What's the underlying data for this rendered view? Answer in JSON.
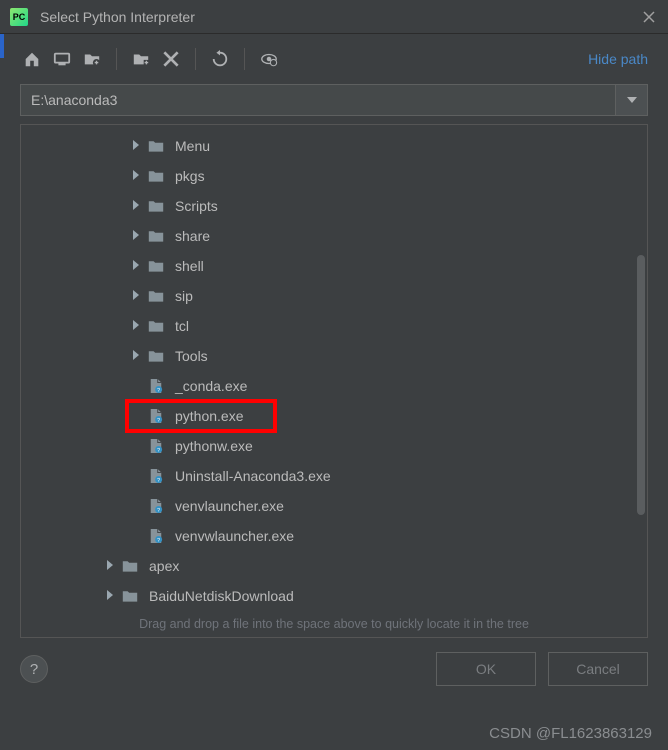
{
  "titlebar": {
    "app_icon_text": "PC",
    "title": "Select Python Interpreter"
  },
  "toolbar": {
    "hide_path_link": "Hide path"
  },
  "path_input": {
    "value": "E:\\anaconda3"
  },
  "tree": {
    "items": [
      {
        "indent": 3,
        "expandable": true,
        "type": "folder",
        "label": "Menu"
      },
      {
        "indent": 3,
        "expandable": true,
        "type": "folder",
        "label": "pkgs"
      },
      {
        "indent": 3,
        "expandable": true,
        "type": "folder",
        "label": "Scripts"
      },
      {
        "indent": 3,
        "expandable": true,
        "type": "folder",
        "label": "share"
      },
      {
        "indent": 3,
        "expandable": true,
        "type": "folder",
        "label": "shell"
      },
      {
        "indent": 3,
        "expandable": true,
        "type": "folder",
        "label": "sip"
      },
      {
        "indent": 3,
        "expandable": true,
        "type": "folder",
        "label": "tcl"
      },
      {
        "indent": 3,
        "expandable": true,
        "type": "folder",
        "label": "Tools"
      },
      {
        "indent": 3,
        "expandable": false,
        "type": "file",
        "label": "_conda.exe"
      },
      {
        "indent": 3,
        "expandable": false,
        "type": "file",
        "label": "python.exe",
        "highlighted": true
      },
      {
        "indent": 3,
        "expandable": false,
        "type": "file",
        "label": "pythonw.exe"
      },
      {
        "indent": 3,
        "expandable": false,
        "type": "file",
        "label": "Uninstall-Anaconda3.exe"
      },
      {
        "indent": 3,
        "expandable": false,
        "type": "file",
        "label": "venvlauncher.exe"
      },
      {
        "indent": 3,
        "expandable": false,
        "type": "file",
        "label": "venvwlauncher.exe"
      },
      {
        "indent": 2,
        "expandable": true,
        "type": "folder",
        "label": "apex"
      },
      {
        "indent": 2,
        "expandable": true,
        "type": "folder",
        "label": "BaiduNetdiskDownload"
      }
    ],
    "hint": "Drag and drop a file into the space above to quickly locate it in the tree"
  },
  "buttons": {
    "ok": "OK",
    "cancel": "Cancel"
  },
  "watermark": "CSDN @FL1623863129"
}
